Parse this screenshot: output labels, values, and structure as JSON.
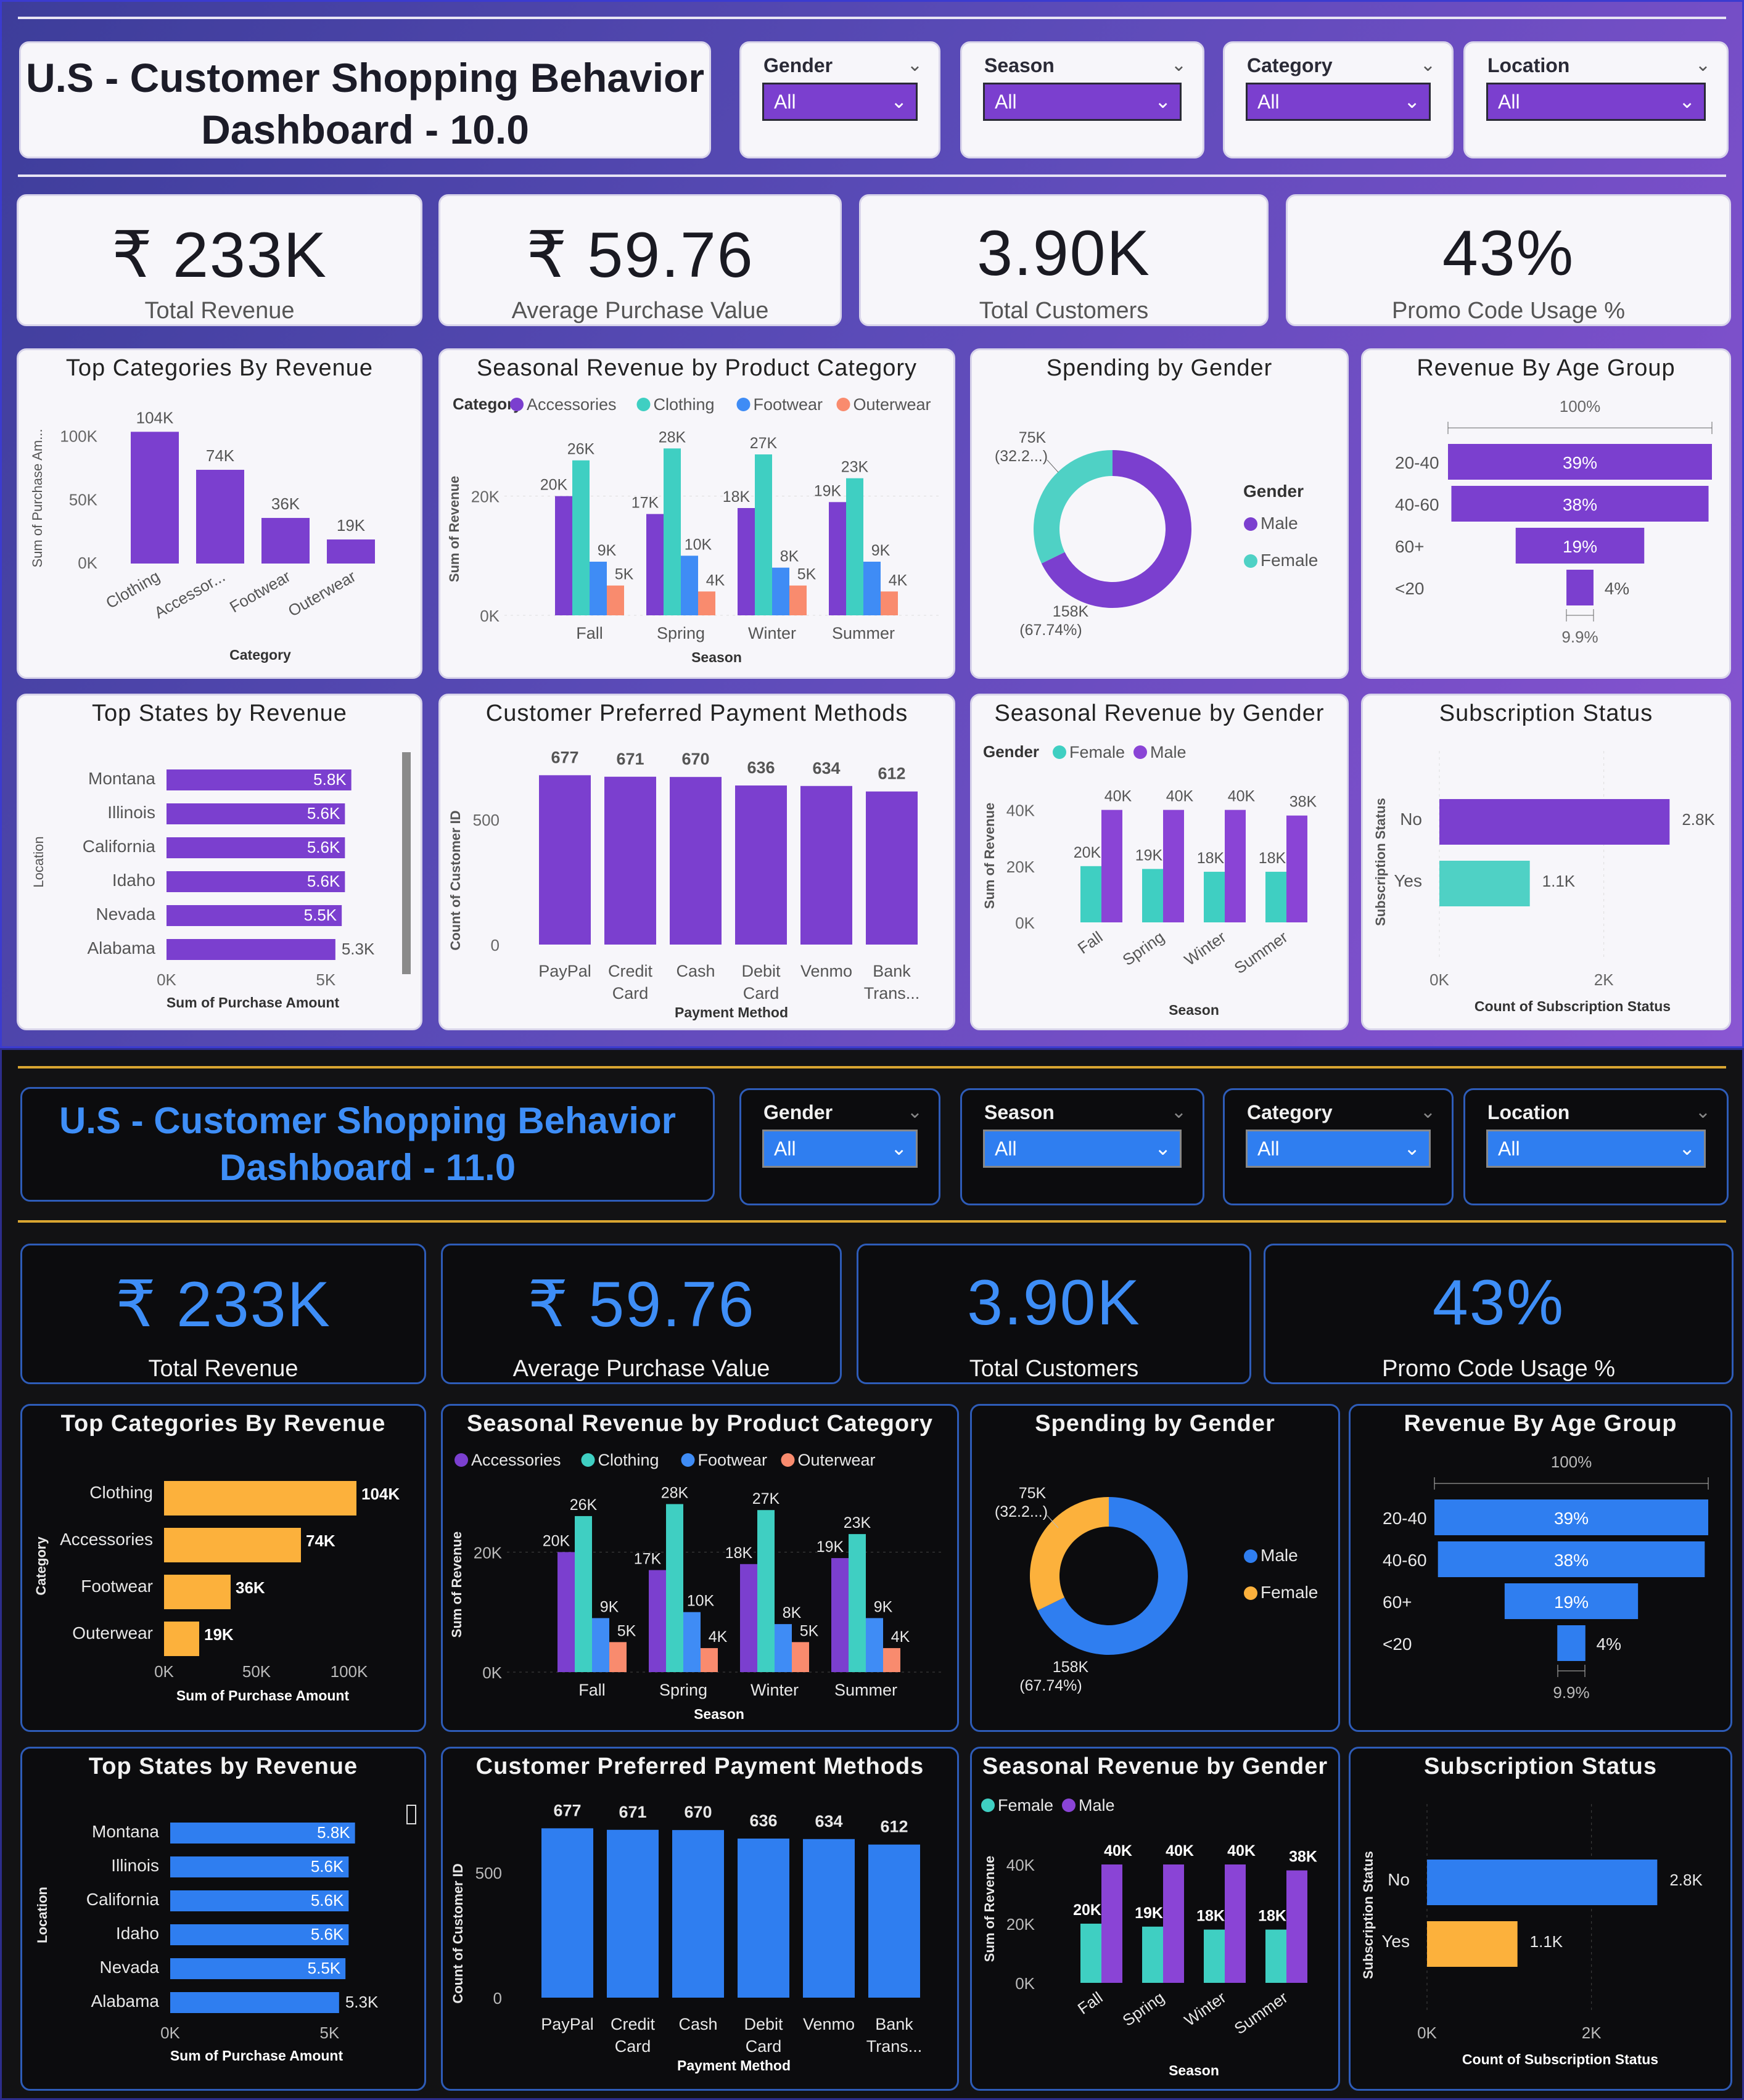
{
  "slicers": [
    {
      "label": "Gender",
      "value": "All"
    },
    {
      "label": "Season",
      "value": "All"
    },
    {
      "label": "Category",
      "value": "All"
    },
    {
      "label": "Location",
      "value": "All"
    }
  ],
  "kpis": [
    {
      "value": "₹ 233K",
      "label": "Total Revenue"
    },
    {
      "value": "₹ 59.76",
      "label": "Average Purchase Value"
    },
    {
      "value": "3.90K",
      "label": "Total Customers"
    },
    {
      "value": "43%",
      "label": "Promo Code Usage %"
    }
  ],
  "panel_titles": {
    "top_categories": "Top Categories By Revenue",
    "seasonal_category": "Seasonal Revenue by Product Category",
    "spending_gender": "Spending by Gender",
    "age_group": "Revenue By Age Group",
    "top_states": "Top States by Revenue",
    "payment": "Customer Preferred Payment Methods",
    "seasonal_gender": "Seasonal Revenue by Gender",
    "subscription": "Subscription Status"
  },
  "colors": {
    "d1_primary": "#7b3fcf",
    "d2_primary": "#2f7ef0",
    "d2_accent": "#fcb13c",
    "accessories": "#7b3fcf",
    "clothing": "#3fcfc2",
    "footwear": "#3f8cf5",
    "outerwear": "#f98b6e",
    "male_d1": "#7b3fcf",
    "female_d1": "#4fd1c5",
    "male_d2": "#2f7ef0",
    "female_d2": "#fcb13c",
    "sg_female": "#3fcfc2",
    "sg_male": "#8a44d6"
  },
  "dashboards": [
    {
      "title_line1": "U.S - Customer Shopping Behavior",
      "title_line2": "Dashboard - 10.0",
      "theme": "light-purple"
    },
    {
      "title_line1": "U.S - Customer Shopping Behavior",
      "title_line2": "Dashboard - 11.0",
      "theme": "dark-blue"
    }
  ],
  "chart_data": [
    {
      "id": "top_categories",
      "type": "bar",
      "title": "Top Categories By Revenue",
      "categories": [
        "Clothing",
        "Accessories",
        "Footwear",
        "Outerwear"
      ],
      "category_labels_d1": [
        "Clothing",
        "Accessor...",
        "Footwear",
        "Outerwear"
      ],
      "values": [
        104000,
        74000,
        36000,
        19000
      ],
      "data_labels": [
        "104K",
        "74K",
        "36K",
        "19K"
      ],
      "xlabel": "Category",
      "ylabel": "Sum of Purchase Am...",
      "ylabel_d2": "Category",
      "xlabel_d2": "Sum of Purchase Amount",
      "ticks": [
        "0K",
        "50K",
        "100K"
      ],
      "ylim": [
        0,
        110000
      ]
    },
    {
      "id": "seasonal_category",
      "type": "bar",
      "title": "Seasonal Revenue by Product Category",
      "legend_title": "Category",
      "categories": [
        "Fall",
        "Spring",
        "Winter",
        "Summer"
      ],
      "series": [
        {
          "name": "Accessories",
          "values": [
            20000,
            17000,
            18000,
            19000
          ],
          "labels": [
            "20K",
            "17K",
            "18K",
            "19K"
          ]
        },
        {
          "name": "Clothing",
          "values": [
            26000,
            28000,
            27000,
            23000
          ],
          "labels": [
            "26K",
            "28K",
            "27K",
            "23K"
          ]
        },
        {
          "name": "Footwear",
          "values": [
            9000,
            10000,
            8000,
            9000
          ],
          "labels": [
            "9K",
            "10K",
            "8K",
            "9K"
          ]
        },
        {
          "name": "Outerwear",
          "values": [
            5000,
            4000,
            5000,
            4000
          ],
          "labels": [
            "5K",
            "4K",
            "5K",
            "4K"
          ]
        }
      ],
      "xlabel": "Season",
      "ylabel": "Sum of Revenue",
      "ticks": [
        "0K",
        "20K"
      ],
      "ylim": [
        0,
        30000
      ]
    },
    {
      "id": "spending_gender",
      "type": "pie",
      "title": "Spending by Gender",
      "legend_title": "Gender",
      "series": [
        {
          "name": "Male",
          "value": 158000,
          "label": "158K",
          "pct": "(67.74%)"
        },
        {
          "name": "Female",
          "value": 75000,
          "label": "75K",
          "pct": "(32.2...)"
        }
      ]
    },
    {
      "id": "age_group",
      "type": "bar",
      "title": "Revenue By Age Group",
      "categories": [
        "20-40",
        "40-60",
        "60+",
        "<20"
      ],
      "values": [
        39,
        38,
        19,
        4
      ],
      "data_labels": [
        "39%",
        "38%",
        "19%",
        "4%"
      ],
      "top_label": "100%",
      "bottom_label": "9.9%"
    },
    {
      "id": "top_states",
      "type": "bar",
      "title": "Top States by Revenue",
      "categories": [
        "Montana",
        "Illinois",
        "California",
        "Idaho",
        "Nevada",
        "Alabama"
      ],
      "values": [
        5800,
        5600,
        5600,
        5600,
        5500,
        5300
      ],
      "data_labels": [
        "5.8K",
        "5.6K",
        "5.6K",
        "5.6K",
        "5.5K",
        "5.3K"
      ],
      "xlabel": "Sum of Purchase Amount",
      "ylabel": "Location",
      "ticks": [
        "0K",
        "5K"
      ],
      "xlim": [
        0,
        6000
      ]
    },
    {
      "id": "payment",
      "type": "bar",
      "title": "Customer Preferred Payment Methods",
      "categories": [
        "PayPal",
        "Credit Card",
        "Cash",
        "Debit Card",
        "Venmo",
        "Bank Trans..."
      ],
      "category_lines": [
        [
          "PayPal"
        ],
        [
          "Credit",
          "Card"
        ],
        [
          "Cash"
        ],
        [
          "Debit",
          "Card"
        ],
        [
          "Venmo"
        ],
        [
          "Bank",
          "Trans..."
        ]
      ],
      "values": [
        677,
        671,
        670,
        636,
        634,
        612
      ],
      "data_labels": [
        "677",
        "671",
        "670",
        "636",
        "634",
        "612"
      ],
      "xlabel": "Payment Method",
      "ylabel": "Count of Customer ID",
      "ticks": [
        "0",
        "500"
      ],
      "ylim": [
        0,
        700
      ]
    },
    {
      "id": "seasonal_gender",
      "type": "bar",
      "title": "Seasonal Revenue by Gender",
      "legend_title": "Gender",
      "categories": [
        "Fall",
        "Spring",
        "Winter",
        "Summer"
      ],
      "series": [
        {
          "name": "Female",
          "values": [
            20000,
            19000,
            18000,
            18000
          ],
          "labels": [
            "20K",
            "19K",
            "18K",
            "18K"
          ]
        },
        {
          "name": "Male",
          "values": [
            40000,
            40000,
            40000,
            38000
          ],
          "labels": [
            "40K",
            "40K",
            "40K",
            "38K"
          ]
        }
      ],
      "xlabel": "Season",
      "ylabel": "Sum of Revenue",
      "ticks": [
        "0K",
        "20K",
        "40K"
      ],
      "ylim": [
        0,
        50000
      ]
    },
    {
      "id": "subscription",
      "type": "bar",
      "title": "Subscription Status",
      "categories": [
        "No",
        "Yes"
      ],
      "values": [
        2800,
        1100
      ],
      "data_labels": [
        "2.8K",
        "1.1K"
      ],
      "xlabel": "Count of Subscription Status",
      "ylabel": "Subscription Status",
      "ticks": [
        "0K",
        "2K"
      ],
      "xlim": [
        0,
        3000
      ]
    }
  ]
}
